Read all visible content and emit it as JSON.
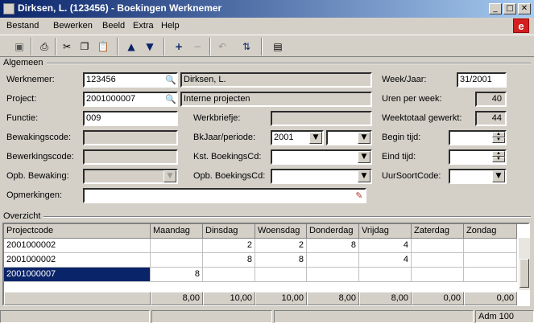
{
  "window": {
    "title": "Dirksen, L. (123456) - Boekingen Werknemer"
  },
  "menu": [
    "Bestand",
    "Bewerken",
    "Beeld",
    "Extra",
    "Help"
  ],
  "groups": {
    "general": "Algemeen",
    "overview": "Overzicht"
  },
  "form": {
    "werknemer_label": "Werknemer:",
    "werknemer_value": "123456",
    "werknemer_name": "Dirksen, L.",
    "project_label": "Project:",
    "project_value": "2001000007",
    "project_name": "Interne projecten",
    "functie_label": "Functie:",
    "functie_value": "009",
    "werkbriefje_label": "Werkbriefje:",
    "bewakingscode_label": "Bewakingscode:",
    "bkjaar_label": "BkJaar/periode:",
    "bkjaar_value": "2001",
    "bewerkingscode_label": "Bewerkingscode:",
    "kst_label": "Kst. BoekingsCd:",
    "opb_bewaking_label": "Opb. Bewaking:",
    "opb_boekingscd_label": "Opb. BoekingsCd:",
    "opmerkingen_label": "Opmerkingen:",
    "weekjaar_label": "Week/Jaar:",
    "weekjaar_value": "31/2001",
    "uren_label": "Uren per week:",
    "uren_value": "40",
    "weektotaal_label": "Weektotaal gewerkt:",
    "weektotaal_value": "44",
    "begin_label": "Begin tijd:",
    "eind_label": "Eind tijd:",
    "uursoort_label": "UurSoortCode:"
  },
  "grid": {
    "columns": [
      "Projectcode",
      "Maandag",
      "Dinsdag",
      "Woensdag",
      "Donderdag",
      "Vrijdag",
      "Zaterdag",
      "Zondag"
    ],
    "rows": [
      [
        "2001000002",
        "",
        "2",
        "2",
        "8",
        "4",
        "",
        ""
      ],
      [
        "2001000002",
        "",
        "8",
        "8",
        "",
        "4",
        "",
        ""
      ],
      [
        "2001000007",
        "8",
        "",
        "",
        "",
        "",
        "",
        ""
      ]
    ],
    "totals": [
      "8,00",
      "10,00",
      "10,00",
      "8,00",
      "8,00",
      "0,00",
      "0,00"
    ]
  },
  "status": {
    "user": "Adm 100"
  },
  "colors": {
    "titlebar": "#0a246a",
    "selection": "#0a246a",
    "brand": "#d31f1f"
  }
}
